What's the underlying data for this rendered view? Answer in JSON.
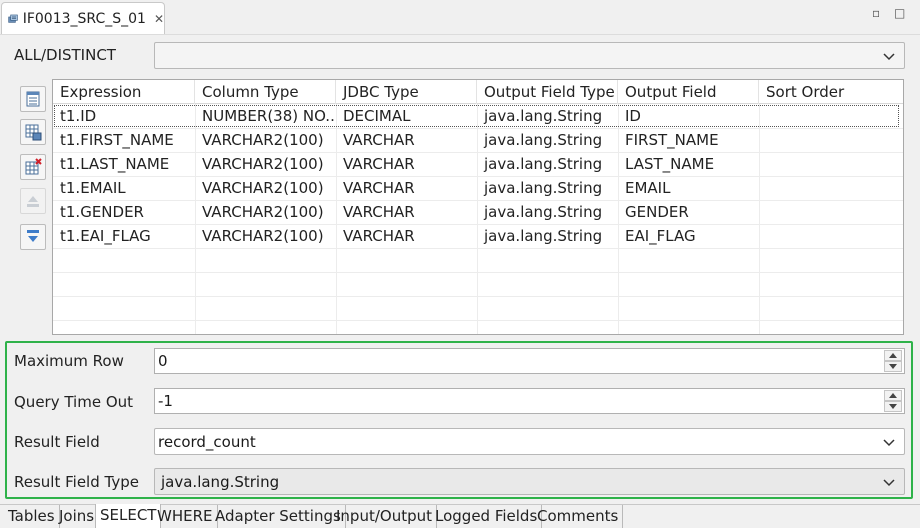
{
  "editor_tab": {
    "title": "IF0013_SRC_S_01"
  },
  "all_distinct": {
    "label": "ALL/DISTINCT",
    "value": ""
  },
  "table": {
    "columns": [
      "Expression",
      "Column Type",
      "JDBC Type",
      "Output Field Type",
      "Output Field",
      "Sort Order"
    ],
    "rows": [
      [
        "t1.ID",
        "NUMBER(38) NO...",
        "DECIMAL",
        "java.lang.String",
        "ID",
        ""
      ],
      [
        "t1.FIRST_NAME",
        "VARCHAR2(100)",
        "VARCHAR",
        "java.lang.String",
        "FIRST_NAME",
        ""
      ],
      [
        "t1.LAST_NAME",
        "VARCHAR2(100)",
        "VARCHAR",
        "java.lang.String",
        "LAST_NAME",
        ""
      ],
      [
        "t1.EMAIL",
        "VARCHAR2(100)",
        "VARCHAR",
        "java.lang.String",
        "EMAIL",
        ""
      ],
      [
        "t1.GENDER",
        "VARCHAR2(100)",
        "VARCHAR",
        "java.lang.String",
        "GENDER",
        ""
      ],
      [
        "t1.EAI_FLAG",
        "VARCHAR2(100)",
        "VARCHAR",
        "java.lang.String",
        "EAI_FLAG",
        ""
      ]
    ]
  },
  "side_buttons": [
    {
      "icon": "add-expression-icon",
      "enabled": true
    },
    {
      "icon": "add-all-columns-icon",
      "enabled": true
    },
    {
      "icon": "delete-row-icon",
      "enabled": true
    },
    {
      "icon": "move-up-icon",
      "enabled": false
    },
    {
      "icon": "move-down-icon",
      "enabled": true
    }
  ],
  "options": {
    "max_row": {
      "label": "Maximum Row",
      "value": "0"
    },
    "query_timeout": {
      "label": "Query Time Out",
      "value": "-1"
    },
    "result_field": {
      "label": "Result Field",
      "value": "record_count"
    },
    "result_field_type": {
      "label": "Result Field Type",
      "value": "java.lang.String"
    }
  },
  "bottom_tabs": [
    {
      "label": "Tables",
      "active": false
    },
    {
      "label": "Joins",
      "active": false
    },
    {
      "label": "SELECT",
      "active": true
    },
    {
      "label": "WHERE",
      "active": false
    },
    {
      "label": "Adapter Settings",
      "active": false
    },
    {
      "label": "Input/Output",
      "active": false
    },
    {
      "label": "Logged Fields",
      "active": false
    },
    {
      "label": "Comments",
      "active": false
    }
  ],
  "colors": {
    "highlight_border": "#2fb24a",
    "selection_outline": "#555555"
  }
}
